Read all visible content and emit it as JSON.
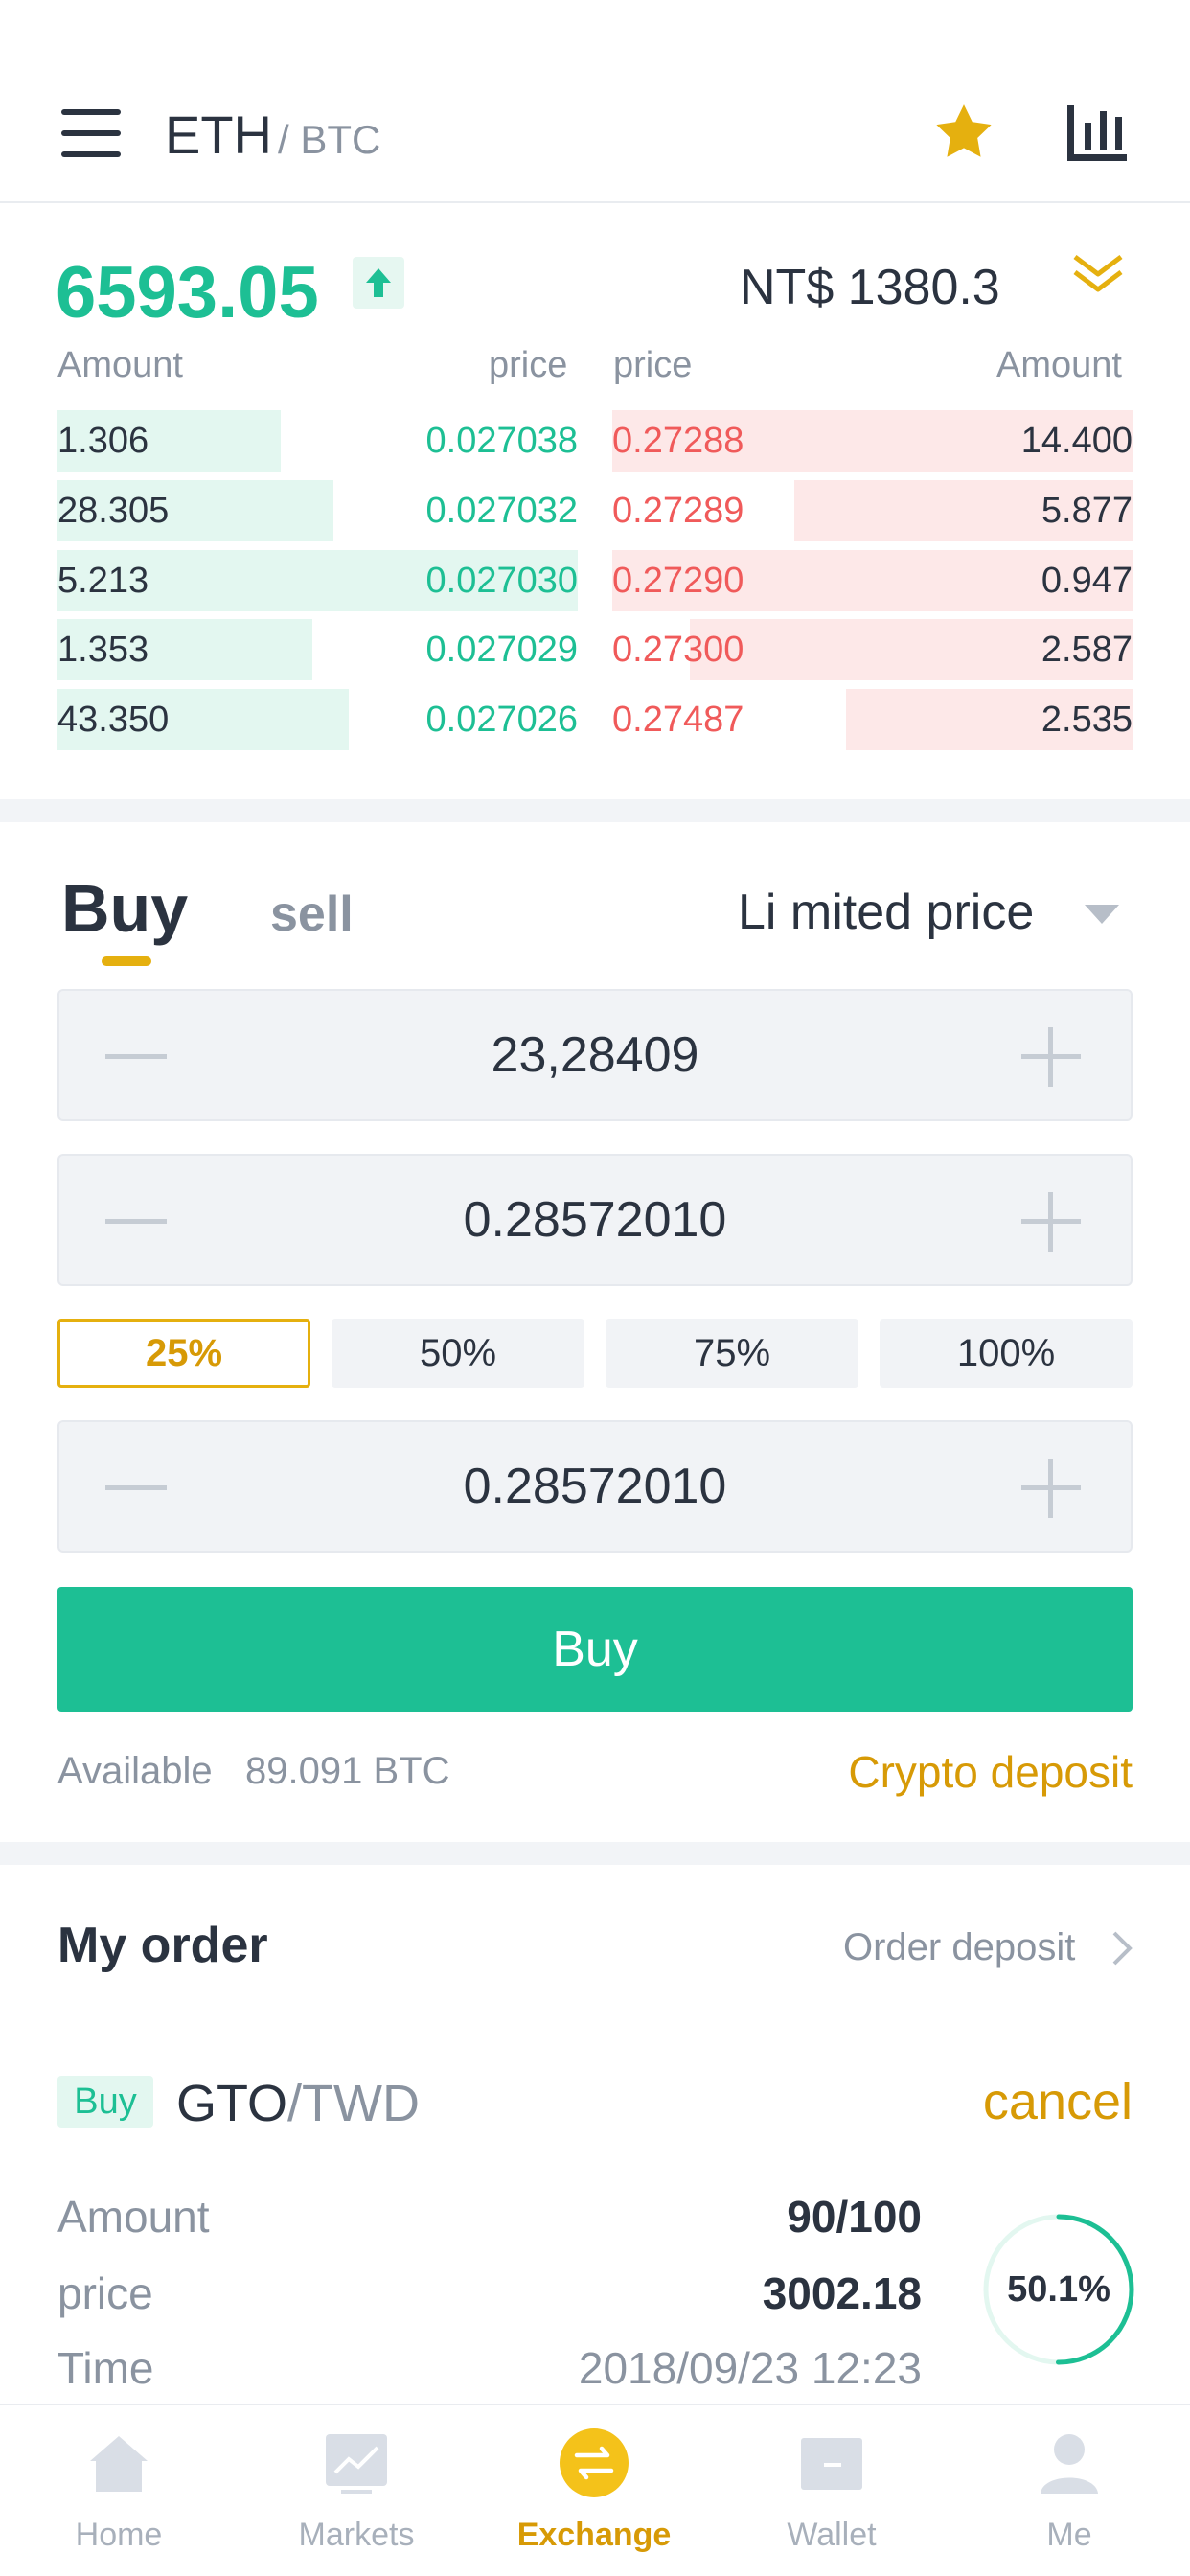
{
  "header": {
    "base": "ETH",
    "quote": "/ BTC",
    "icons": [
      "menu-icon",
      "star-icon",
      "bar-chart-icon"
    ]
  },
  "ticker": {
    "last_price": "6593.05",
    "fiat_price": "NT$ 1380.3",
    "trend_icon": "arrow-up-icon",
    "up_color": "#1dbf94",
    "down_color": "#f05a5a"
  },
  "orderbook": {
    "bid_headers": [
      "Amount",
      "price"
    ],
    "ask_headers": [
      "price",
      "Amount"
    ],
    "bids": [
      {
        "amount": "1.306",
        "price": "0.027038",
        "depth": 0.43
      },
      {
        "amount": "28.305",
        "price": "0.027032",
        "depth": 0.53
      },
      {
        "amount": "5.213",
        "price": "0.027030",
        "depth": 1.0
      },
      {
        "amount": "1.353",
        "price": "0.027029",
        "depth": 0.49
      },
      {
        "amount": "43.350",
        "price": "0.027026",
        "depth": 0.56
      }
    ],
    "asks": [
      {
        "price": "0.27288",
        "amount": "14.400",
        "depth": 1.0
      },
      {
        "price": "0.27289",
        "amount": "5.877",
        "depth": 0.65
      },
      {
        "price": "0.27290",
        "amount": "0.947",
        "depth": 1.0
      },
      {
        "price": "0.27300",
        "amount": "2.587",
        "depth": 0.85
      },
      {
        "price": "0.27487",
        "amount": "2.535",
        "depth": 0.55
      }
    ]
  },
  "trade": {
    "tab_buy": "Buy",
    "tab_sell": "sell",
    "order_type": "Li mited price",
    "price_value": "23,28409",
    "amount_value": "0.28572010",
    "total_value": "0.28572010",
    "percents": [
      "25%",
      "50%",
      "75%",
      "100%"
    ],
    "active_percent": "25%",
    "buy_button": "Buy",
    "available_label": "Available",
    "available_value": "89.091 BTC",
    "deposit_link": "Crypto deposit",
    "accent": "#e5b00f"
  },
  "my_order": {
    "title": "My order",
    "deposit_link": "Order deposit",
    "order": {
      "side": "Buy",
      "base": "GTO",
      "quote": "/TWD",
      "cancel": "cancel",
      "amount_label": "Amount",
      "amount_value": "90/100",
      "price_label": "price",
      "price_value": "3002.18",
      "time_label": "Time",
      "time_value": "2018/09/23  12:23",
      "progress_text": "50.1%",
      "progress": 0.501
    }
  },
  "tabbar": {
    "tabs": [
      {
        "label": "Home",
        "icon": "home-icon"
      },
      {
        "label": "Markets",
        "icon": "markets-icon"
      },
      {
        "label": "Exchange",
        "icon": "exchange-icon"
      },
      {
        "label": "Wallet",
        "icon": "wallet-icon"
      },
      {
        "label": "Me",
        "icon": "profile-icon"
      }
    ],
    "active": "Exchange"
  }
}
